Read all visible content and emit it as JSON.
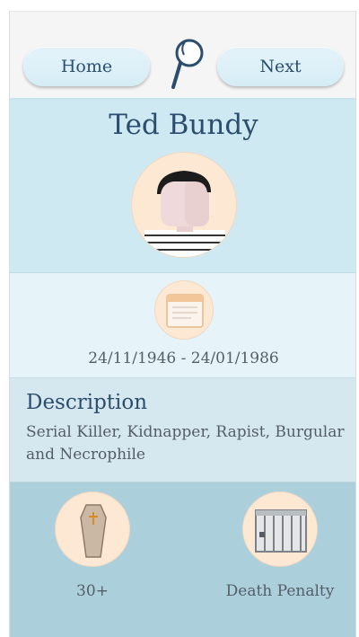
{
  "header": {
    "home_label": "Home",
    "next_label": "Next",
    "logo_icon": "magnifier-logo-icon"
  },
  "profile": {
    "name": "Ted Bundy",
    "avatar_icon": "person-avatar-icon"
  },
  "dates": {
    "icon": "calendar-icon",
    "range": "24/11/1946 - 24/01/1986"
  },
  "description": {
    "title": "Description",
    "text": "Serial Killer, Kidnapper, Rapist, Burgular and Necrophile"
  },
  "stats": {
    "victims": {
      "icon": "coffin-icon",
      "value": "30+"
    },
    "sentence": {
      "icon": "prison-cell-icon",
      "value": "Death Penalty"
    }
  },
  "colors": {
    "title_blue": "#2b4d6e",
    "profile_bg": "#cfe9f3",
    "dates_bg": "#e6f4fa",
    "desc_bg": "#d5e8ef",
    "stats_bg": "#abd0dc",
    "circle_bg": "#fde8d4"
  }
}
